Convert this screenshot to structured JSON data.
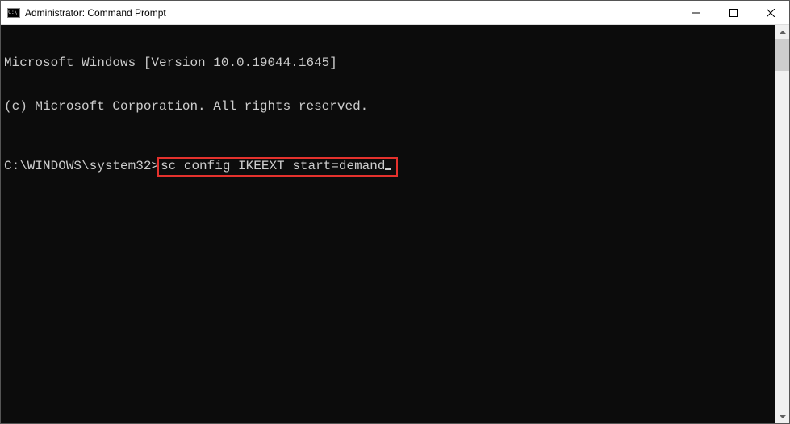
{
  "window": {
    "title": "Administrator: Command Prompt"
  },
  "console": {
    "line1": "Microsoft Windows [Version 10.0.19044.1645]",
    "line2": "(c) Microsoft Corporation. All rights reserved.",
    "prompt": "C:\\WINDOWS\\system32>",
    "command": "sc config IKEEXT start=demand"
  }
}
